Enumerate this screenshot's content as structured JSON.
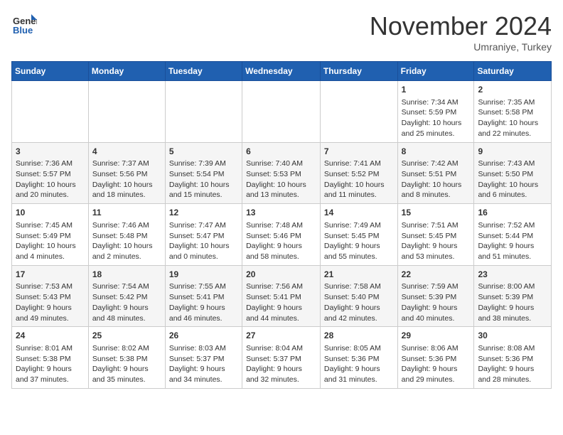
{
  "logo": {
    "line1": "General",
    "line2": "Blue"
  },
  "title": "November 2024",
  "location": "Umraniye, Turkey",
  "days_of_week": [
    "Sunday",
    "Monday",
    "Tuesday",
    "Wednesday",
    "Thursday",
    "Friday",
    "Saturday"
  ],
  "weeks": [
    [
      {
        "day": "",
        "info": ""
      },
      {
        "day": "",
        "info": ""
      },
      {
        "day": "",
        "info": ""
      },
      {
        "day": "",
        "info": ""
      },
      {
        "day": "",
        "info": ""
      },
      {
        "day": "1",
        "info": "Sunrise: 7:34 AM\nSunset: 5:59 PM\nDaylight: 10 hours and 25 minutes."
      },
      {
        "day": "2",
        "info": "Sunrise: 7:35 AM\nSunset: 5:58 PM\nDaylight: 10 hours and 22 minutes."
      }
    ],
    [
      {
        "day": "3",
        "info": "Sunrise: 7:36 AM\nSunset: 5:57 PM\nDaylight: 10 hours and 20 minutes."
      },
      {
        "day": "4",
        "info": "Sunrise: 7:37 AM\nSunset: 5:56 PM\nDaylight: 10 hours and 18 minutes."
      },
      {
        "day": "5",
        "info": "Sunrise: 7:39 AM\nSunset: 5:54 PM\nDaylight: 10 hours and 15 minutes."
      },
      {
        "day": "6",
        "info": "Sunrise: 7:40 AM\nSunset: 5:53 PM\nDaylight: 10 hours and 13 minutes."
      },
      {
        "day": "7",
        "info": "Sunrise: 7:41 AM\nSunset: 5:52 PM\nDaylight: 10 hours and 11 minutes."
      },
      {
        "day": "8",
        "info": "Sunrise: 7:42 AM\nSunset: 5:51 PM\nDaylight: 10 hours and 8 minutes."
      },
      {
        "day": "9",
        "info": "Sunrise: 7:43 AM\nSunset: 5:50 PM\nDaylight: 10 hours and 6 minutes."
      }
    ],
    [
      {
        "day": "10",
        "info": "Sunrise: 7:45 AM\nSunset: 5:49 PM\nDaylight: 10 hours and 4 minutes."
      },
      {
        "day": "11",
        "info": "Sunrise: 7:46 AM\nSunset: 5:48 PM\nDaylight: 10 hours and 2 minutes."
      },
      {
        "day": "12",
        "info": "Sunrise: 7:47 AM\nSunset: 5:47 PM\nDaylight: 10 hours and 0 minutes."
      },
      {
        "day": "13",
        "info": "Sunrise: 7:48 AM\nSunset: 5:46 PM\nDaylight: 9 hours and 58 minutes."
      },
      {
        "day": "14",
        "info": "Sunrise: 7:49 AM\nSunset: 5:45 PM\nDaylight: 9 hours and 55 minutes."
      },
      {
        "day": "15",
        "info": "Sunrise: 7:51 AM\nSunset: 5:45 PM\nDaylight: 9 hours and 53 minutes."
      },
      {
        "day": "16",
        "info": "Sunrise: 7:52 AM\nSunset: 5:44 PM\nDaylight: 9 hours and 51 minutes."
      }
    ],
    [
      {
        "day": "17",
        "info": "Sunrise: 7:53 AM\nSunset: 5:43 PM\nDaylight: 9 hours and 49 minutes."
      },
      {
        "day": "18",
        "info": "Sunrise: 7:54 AM\nSunset: 5:42 PM\nDaylight: 9 hours and 48 minutes."
      },
      {
        "day": "19",
        "info": "Sunrise: 7:55 AM\nSunset: 5:41 PM\nDaylight: 9 hours and 46 minutes."
      },
      {
        "day": "20",
        "info": "Sunrise: 7:56 AM\nSunset: 5:41 PM\nDaylight: 9 hours and 44 minutes."
      },
      {
        "day": "21",
        "info": "Sunrise: 7:58 AM\nSunset: 5:40 PM\nDaylight: 9 hours and 42 minutes."
      },
      {
        "day": "22",
        "info": "Sunrise: 7:59 AM\nSunset: 5:39 PM\nDaylight: 9 hours and 40 minutes."
      },
      {
        "day": "23",
        "info": "Sunrise: 8:00 AM\nSunset: 5:39 PM\nDaylight: 9 hours and 38 minutes."
      }
    ],
    [
      {
        "day": "24",
        "info": "Sunrise: 8:01 AM\nSunset: 5:38 PM\nDaylight: 9 hours and 37 minutes."
      },
      {
        "day": "25",
        "info": "Sunrise: 8:02 AM\nSunset: 5:38 PM\nDaylight: 9 hours and 35 minutes."
      },
      {
        "day": "26",
        "info": "Sunrise: 8:03 AM\nSunset: 5:37 PM\nDaylight: 9 hours and 34 minutes."
      },
      {
        "day": "27",
        "info": "Sunrise: 8:04 AM\nSunset: 5:37 PM\nDaylight: 9 hours and 32 minutes."
      },
      {
        "day": "28",
        "info": "Sunrise: 8:05 AM\nSunset: 5:36 PM\nDaylight: 9 hours and 31 minutes."
      },
      {
        "day": "29",
        "info": "Sunrise: 8:06 AM\nSunset: 5:36 PM\nDaylight: 9 hours and 29 minutes."
      },
      {
        "day": "30",
        "info": "Sunrise: 8:08 AM\nSunset: 5:36 PM\nDaylight: 9 hours and 28 minutes."
      }
    ]
  ]
}
